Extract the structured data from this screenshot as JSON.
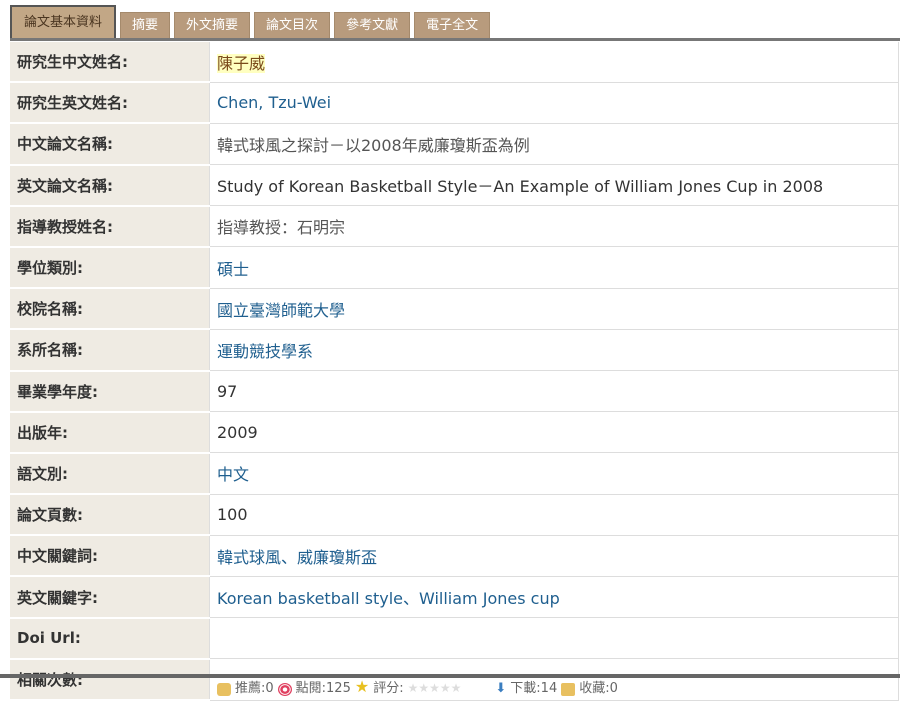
{
  "tabs": [
    "論文基本資料",
    "摘要",
    "外文摘要",
    "論文目次",
    "參考文獻",
    "電子全文"
  ],
  "rows": [
    {
      "label": "研究生中文姓名:",
      "value": "陳子威",
      "style": "hl"
    },
    {
      "label": "研究生英文姓名:",
      "value": "Chen, Tzu-Wei",
      "style": "link"
    },
    {
      "label": "中文論文名稱:",
      "value": "韓式球風之探討－以2008年威廉瓊斯盃為例",
      "style": "gray"
    },
    {
      "label": "英文論文名稱:",
      "value": "Study of Korean Basketball Style－An Example of William Jones Cup in 2008",
      "style": "dark"
    },
    {
      "label": "指導教授姓名:",
      "value": "指導教授：石明宗",
      "style": "gray"
    },
    {
      "label": "學位類別:",
      "value": "碩士",
      "style": "link"
    },
    {
      "label": "校院名稱:",
      "value": "國立臺灣師範大學",
      "style": "link"
    },
    {
      "label": "系所名稱:",
      "value": "運動競技學系",
      "style": "link"
    },
    {
      "label": "畢業學年度:",
      "value": "97",
      "style": "dark"
    },
    {
      "label": "出版年:",
      "value": "2009",
      "style": "dark"
    },
    {
      "label": "語文別:",
      "value": "中文",
      "style": "link"
    },
    {
      "label": "論文頁數:",
      "value": "100",
      "style": "dark"
    },
    {
      "label": "中文關鍵詞:",
      "value": "韓式球風、威廉瓊斯盃",
      "style": "link"
    },
    {
      "label": "英文關鍵字:",
      "value": "Korean basketball style、William Jones cup",
      "style": "link"
    },
    {
      "label": "Doi Url:",
      "value": "",
      "style": "dark"
    }
  ],
  "stats": {
    "label": "相關次數:",
    "recommend": "推薦:0",
    "views": "點閱:125",
    "rating": "評分:",
    "rating_value": 0,
    "downloads": "下載:14",
    "favorites": "收藏:0"
  }
}
